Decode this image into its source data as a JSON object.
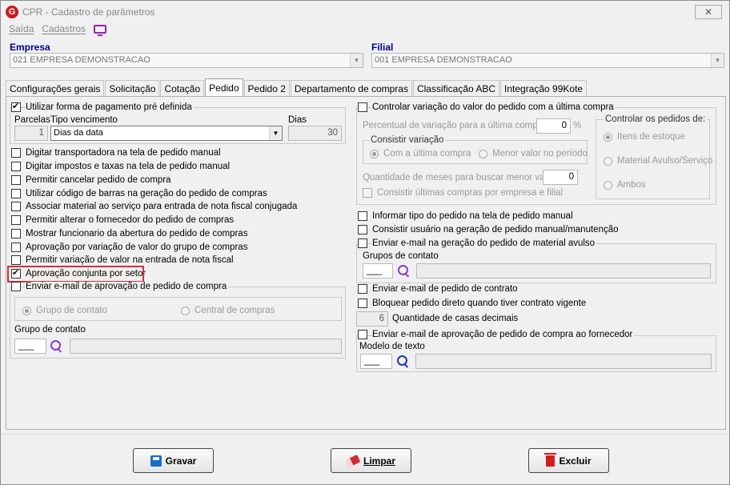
{
  "window": {
    "title": "CPR - Cadastro de parâmetros",
    "close_label": "✕",
    "app_icon_letter": "G"
  },
  "menu": {
    "items": [
      "Saída",
      "Cadastros"
    ]
  },
  "empresa": {
    "label": "Empresa",
    "value": "021 EMPRESA DEMONSTRACAO"
  },
  "filial": {
    "label": "Filial",
    "value": "001 EMPRESA DEMONSTRACAO"
  },
  "tabs": [
    "Configurações gerais",
    "Solicitação",
    "Cotação",
    "Pedido",
    "Pedido 2",
    "Departamento de compras",
    "Classificação ABC",
    "Integração 99Kote"
  ],
  "active_tab": "Pedido",
  "left": {
    "pagamento": {
      "label": "Utilizar forma de pagamento pré definida",
      "checked": true,
      "parcelas_label": "Parcelas",
      "parcelas_value": "1",
      "tipo_label": "Tipo vencimento",
      "tipo_value": "Dias da data",
      "dias_label": "Dias",
      "dias_value": "30"
    },
    "options": [
      {
        "label": "Digitar transportadora na tela de pedido manual",
        "checked": false
      },
      {
        "label": "Digitar impostos e taxas na tela de pedido manual",
        "checked": false
      },
      {
        "label": "Permitir cancelar pedido de compra",
        "checked": false
      },
      {
        "label": "Utilizar código de barras na geração do pedido de compras",
        "checked": false
      },
      {
        "label": "Associar material ao serviço para entrada de nota fiscal conjugada",
        "checked": false
      },
      {
        "label": "Permitir alterar o fornecedor do pedido de compras",
        "checked": false
      },
      {
        "label": "Mostrar funcionario da abertura do pedido de compras",
        "checked": false
      },
      {
        "label": "Aprovação por variação de valor do grupo de compras",
        "checked": false
      },
      {
        "label": "Permitir variação de valor na entrada de nota fiscal",
        "checked": false
      },
      {
        "label": "Aprovação conjunta por setor",
        "checked": true
      }
    ],
    "email_aprovacao": {
      "label": "Enviar e-mail de aprovação de pedido de compra",
      "radio_1": "Grupo de contato",
      "radio_2": "Central de compras",
      "grupo_label": "Grupo de contato",
      "grupo_code": "___"
    }
  },
  "right": {
    "variacao": {
      "label": "Controlar variação do valor do pedido com a última compra",
      "percentual_label": "Percentual de variação para a última compra",
      "percentual_value": "0",
      "percent_sign": "%",
      "consistir_label": "Consistir variação",
      "radio_1": "Com a última compra",
      "radio_2": "Menor valor no período",
      "meses_label": "Quantidade de meses para buscar menor valor",
      "meses_value": "0",
      "consistir_empresa_label": "Consistir últimas compras por empresa e filial",
      "controlar_label": "Controlar os pedidos de:",
      "ctrl_1": "Itens de estoque",
      "ctrl_2": "Material Avulso/Serviço",
      "ctrl_3": "Ambos"
    },
    "informar_tipo": "Informar tipo do pedido na tela de pedido manual",
    "consistir_usuario": "Consistir usuário na geração de pedido manual/manutenção",
    "email_avulso": {
      "label": "Enviar e-mail na geração do pedido de material avulso",
      "grupos_label": "Grupos de contato",
      "code": "___"
    },
    "email_contrato": "Enviar e-mail de pedido de contrato",
    "bloquear": "Bloquear pedido direto quando tiver contrato vigente",
    "casas_value": "6",
    "casas_label": "Quantidade de casas decimais",
    "email_fornecedor": {
      "label": "Enviar e-mail de aprovação de pedido de compra ao fornecedor",
      "modelo_label": "Modelo de texto",
      "code": "___"
    }
  },
  "buttons": {
    "gravar": "Gravar",
    "limpar": "Limpar",
    "excluir": "Excluir"
  }
}
